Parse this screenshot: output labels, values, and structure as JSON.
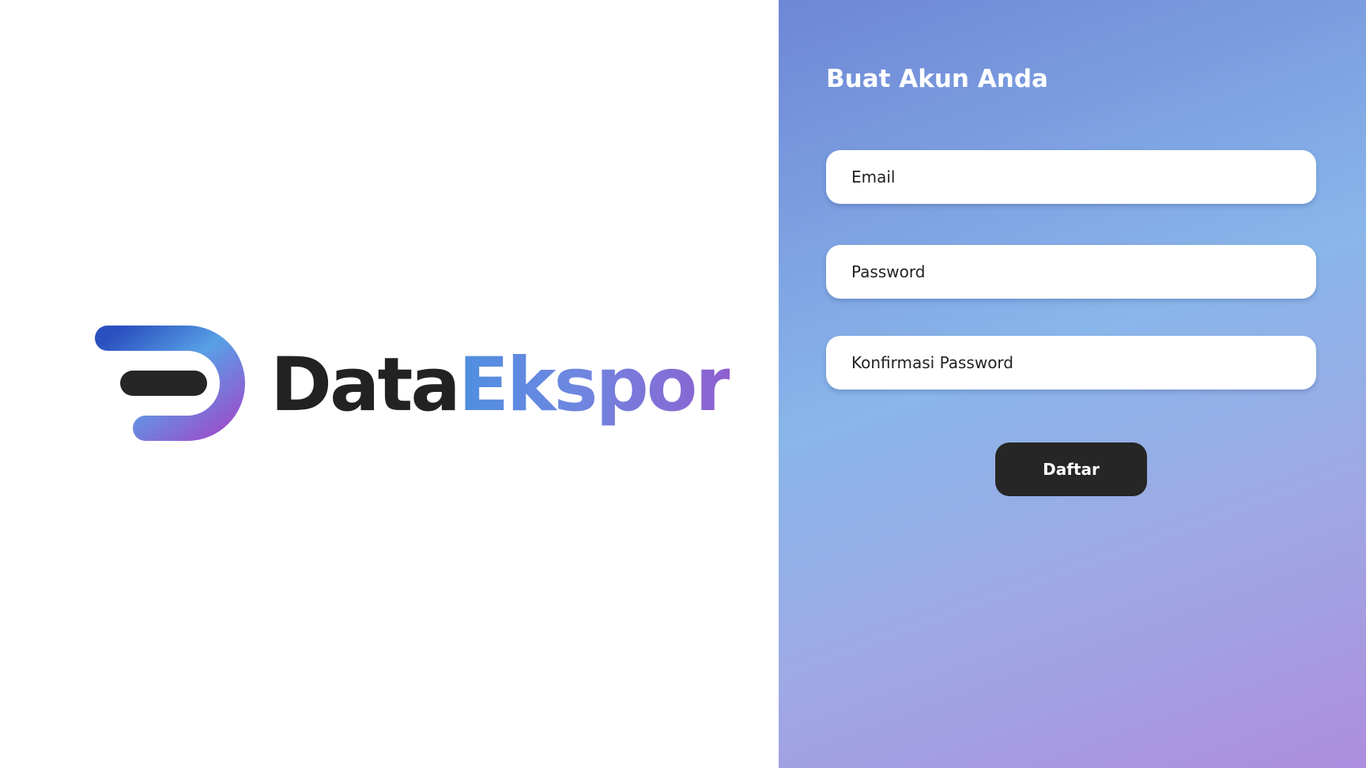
{
  "brand": {
    "name_part_1": "Data",
    "name_part_2": "Ekspor",
    "colors": {
      "dark": "#222222",
      "accent_start": "#4f8fe0",
      "accent_end": "#8f5fcf"
    }
  },
  "form": {
    "title": "Buat Akun Anda",
    "email_placeholder": "Email",
    "password_placeholder": "Password",
    "confirm_password_placeholder": "Konfirmasi Password",
    "submit_label": "Daftar"
  },
  "theme": {
    "panel_gradient_start": "#6e86d6",
    "panel_gradient_mid": "#89b6ea",
    "panel_gradient_end": "#ad8ede",
    "button_color": "#262626"
  },
  "icons": {
    "logo": "dataekspor-logo-mark"
  }
}
